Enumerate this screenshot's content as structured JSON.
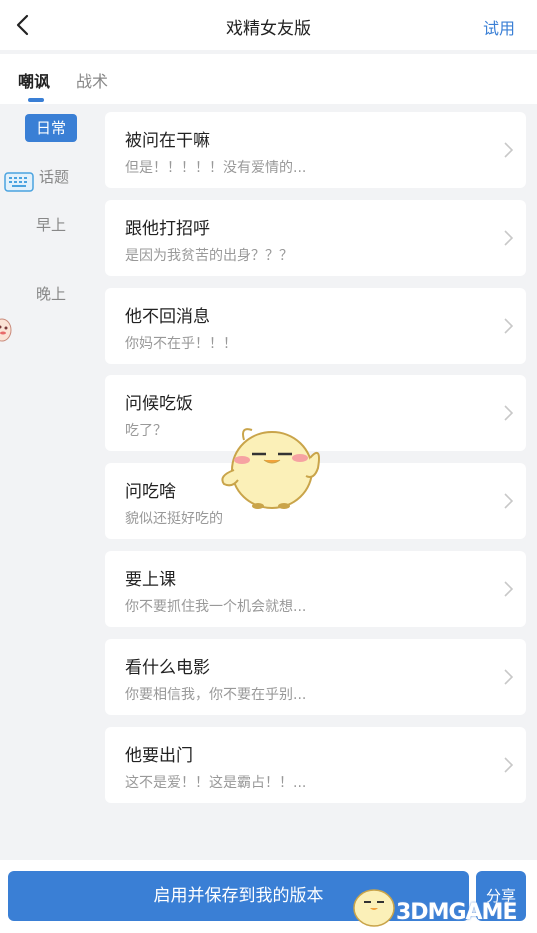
{
  "header": {
    "title": "戏精女友版",
    "try_label": "试用"
  },
  "tabs": [
    {
      "label": "嘲讽"
    },
    {
      "label": "战术"
    }
  ],
  "sidebar": {
    "items": [
      {
        "label": "日常",
        "active": true
      },
      {
        "label": "话题"
      },
      {
        "label": "早上"
      },
      {
        "label": "晚上"
      }
    ]
  },
  "list": [
    {
      "title": "被问在干嘛",
      "subtitle": "但是！！！！！没有爱情的..."
    },
    {
      "title": "跟他打招呼",
      "subtitle": "是因为我贫苦的出身？？？"
    },
    {
      "title": "他不回消息",
      "subtitle": "你妈不在乎！！！"
    },
    {
      "title": "问候吃饭",
      "subtitle": "吃了？"
    },
    {
      "title": "问吃啥",
      "subtitle": "貌似还挺好吃的"
    },
    {
      "title": "要上课",
      "subtitle": "你不要抓住我一个机会就想..."
    },
    {
      "title": "看什么电影",
      "subtitle": "你要相信我，你不要在乎别..."
    },
    {
      "title": "他要出门",
      "subtitle": "这不是爱！！这是霸占！！..."
    }
  ],
  "bottom": {
    "save_label": "启用并保存到我的版本",
    "share_label": "分享"
  },
  "watermark": {
    "text": "3DMGAME"
  },
  "colors": {
    "accent": "#3a7fd5",
    "background": "#f2f3f5"
  }
}
